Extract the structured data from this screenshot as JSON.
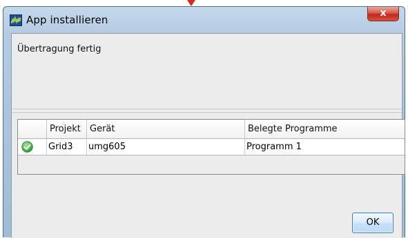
{
  "window": {
    "title": "App installieren",
    "close_label": "x"
  },
  "status_message": "Übertragung fertig",
  "table": {
    "headers": [
      "",
      "Projekt",
      "Gerät",
      "Belegte Programme"
    ],
    "rows": [
      {
        "status_icon": "check-circle-icon",
        "status_color": "#3fae3f",
        "projekt": "Grid3",
        "geraet": "umg605",
        "belegte_programme": "Programm 1"
      }
    ]
  },
  "buttons": {
    "ok_label": "OK"
  },
  "colors": {
    "pointer_arrow": "#d6291c",
    "close_button": "#c2271a",
    "ok_border": "#3c7fb1"
  }
}
